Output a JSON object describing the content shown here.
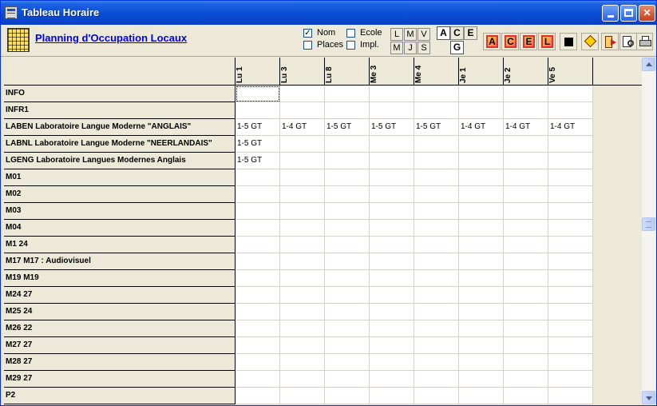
{
  "window": {
    "title": "Tableau Horaire"
  },
  "toolbar": {
    "link": "Planning d'Occupation Locaux",
    "options": [
      {
        "label": "Nom",
        "checked": true
      },
      {
        "label": "Places",
        "checked": false
      },
      {
        "label": "Ecole",
        "checked": false
      },
      {
        "label": "Impl.",
        "checked": false
      }
    ],
    "days": [
      "L",
      "M",
      "V",
      "M",
      "J",
      "S"
    ],
    "modes": [
      "A",
      "C",
      "E",
      "G"
    ],
    "tool_letters": [
      "A",
      "C",
      "E",
      "L"
    ]
  },
  "grid": {
    "columns": [
      "Lu 1",
      "Lu 3",
      "Lu 8",
      "Me 3",
      "Me 4",
      "Je 1",
      "Je 2",
      "Ve 5"
    ],
    "rows": [
      {
        "label": "INFO",
        "cells": [
          "",
          "",
          "",
          "",
          "",
          "",
          "",
          ""
        ]
      },
      {
        "label": "INFR1",
        "cells": [
          "",
          "",
          "",
          "",
          "",
          "",
          "",
          ""
        ]
      },
      {
        "label": "LABEN Laboratoire Langue Moderne \"ANGLAIS\"",
        "cells": [
          "1-5 GT",
          "1-4 GT",
          "1-5 GT",
          "1-5 GT",
          "1-5 GT",
          "1-4 GT",
          "1-4 GT",
          "1-4 GT"
        ]
      },
      {
        "label": "LABNL Laboratoire Langue Moderne \"NEERLANDAIS\"",
        "cells": [
          "1-5 GT",
          "",
          "",
          "",
          "",
          "",
          "",
          ""
        ]
      },
      {
        "label": "LGENG Laboratoire Langues Modernes Anglais",
        "cells": [
          "1-5 GT",
          "",
          "",
          "",
          "",
          "",
          "",
          ""
        ]
      },
      {
        "label": "M01",
        "cells": [
          "",
          "",
          "",
          "",
          "",
          "",
          "",
          ""
        ]
      },
      {
        "label": "M02",
        "cells": [
          "",
          "",
          "",
          "",
          "",
          "",
          "",
          ""
        ]
      },
      {
        "label": "M03",
        "cells": [
          "",
          "",
          "",
          "",
          "",
          "",
          "",
          ""
        ]
      },
      {
        "label": "M04",
        "cells": [
          "",
          "",
          "",
          "",
          "",
          "",
          "",
          ""
        ]
      },
      {
        "label": "M1 24",
        "cells": [
          "",
          "",
          "",
          "",
          "",
          "",
          "",
          ""
        ]
      },
      {
        "label": "M17 M17 : Audiovisuel",
        "cells": [
          "",
          "",
          "",
          "",
          "",
          "",
          "",
          ""
        ]
      },
      {
        "label": "M19 M19",
        "cells": [
          "",
          "",
          "",
          "",
          "",
          "",
          "",
          ""
        ]
      },
      {
        "label": "M24 27",
        "cells": [
          "",
          "",
          "",
          "",
          "",
          "",
          "",
          ""
        ]
      },
      {
        "label": "M25 24",
        "cells": [
          "",
          "",
          "",
          "",
          "",
          "",
          "",
          ""
        ]
      },
      {
        "label": "M26 22",
        "cells": [
          "",
          "",
          "",
          "",
          "",
          "",
          "",
          ""
        ]
      },
      {
        "label": "M27 27",
        "cells": [
          "",
          "",
          "",
          "",
          "",
          "",
          "",
          ""
        ]
      },
      {
        "label": "M28 27",
        "cells": [
          "",
          "",
          "",
          "",
          "",
          "",
          "",
          ""
        ]
      },
      {
        "label": "M29 27",
        "cells": [
          "",
          "",
          "",
          "",
          "",
          "",
          "",
          ""
        ]
      },
      {
        "label": "P2",
        "cells": [
          "",
          "",
          "",
          "",
          "",
          "",
          "",
          ""
        ]
      }
    ]
  }
}
